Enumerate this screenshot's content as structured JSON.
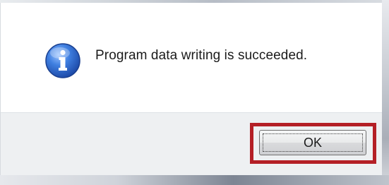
{
  "dialog": {
    "message": "Program data writing is succeeded.",
    "icon": "information-icon",
    "ok_label": "OK"
  },
  "colors": {
    "highlight": "#b41f26",
    "icon_blue": "#2a63c8",
    "button_bar": "#eef0f2"
  }
}
